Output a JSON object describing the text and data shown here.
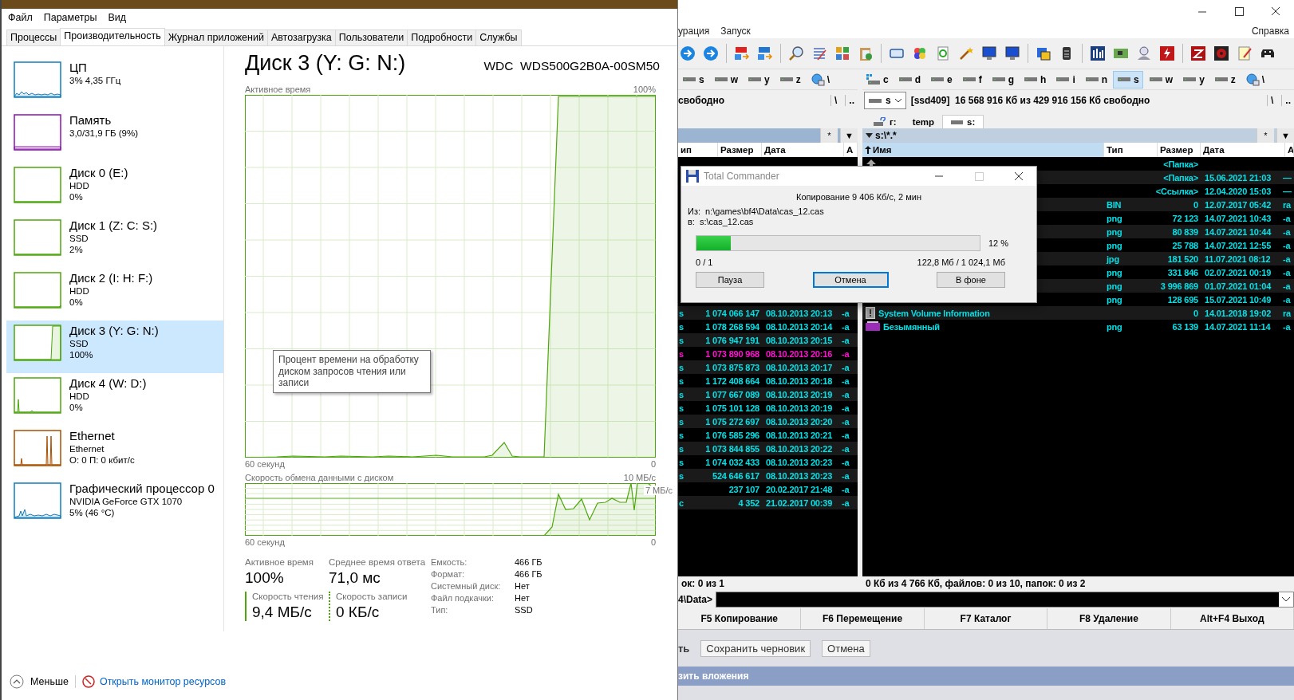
{
  "task_manager": {
    "menu": [
      "Файл",
      "Параметры",
      "Вид"
    ],
    "tabs": [
      {
        "label": "Процессы",
        "selected": false
      },
      {
        "label": "Производительность",
        "selected": true
      },
      {
        "label": "Журнал приложений",
        "selected": false
      },
      {
        "label": "Автозагрузка",
        "selected": false
      },
      {
        "label": "Пользователи",
        "selected": false
      },
      {
        "label": "Подробности",
        "selected": false
      },
      {
        "label": "Службы",
        "selected": false
      }
    ],
    "devices": [
      {
        "name": "ЦП",
        "lines": [
          "3% 4,35 ГГц"
        ],
        "kind": "cpu",
        "selected": false
      },
      {
        "name": "Память",
        "lines": [
          "3,0/31,9 ГБ (9%)"
        ],
        "kind": "memory",
        "selected": false
      },
      {
        "name": "Диск 0 (E:)",
        "lines": [
          "HDD",
          "0%"
        ],
        "kind": "disk",
        "selected": false
      },
      {
        "name": "Диск 1 (Z: C: S:)",
        "lines": [
          "SSD",
          "2%"
        ],
        "kind": "disk",
        "selected": false
      },
      {
        "name": "Диск 2 (I: H: F:)",
        "lines": [
          "HDD",
          "0%"
        ],
        "kind": "disk",
        "selected": false
      },
      {
        "name": "Диск 3 (Y: G: N:)",
        "lines": [
          "SSD",
          "100%"
        ],
        "kind": "disk",
        "selected": true
      },
      {
        "name": "Диск 4 (W: D:)",
        "lines": [
          "HDD",
          "0%"
        ],
        "kind": "disk",
        "selected": false
      },
      {
        "name": "Ethernet",
        "lines": [
          "Ethernet",
          "О: 0 П: 0 кбит/с"
        ],
        "kind": "ethernet",
        "selected": false
      },
      {
        "name": "Графический процессор 0",
        "lines": [
          "NVIDIA GeForce GTX 1070",
          "5%  (46 °C)"
        ],
        "kind": "gpu",
        "selected": false
      }
    ],
    "detail": {
      "title": "Диск 3 (Y: G: N:)",
      "model": "WDC  WDS500G2B0A-00SM50",
      "chart1": {
        "label": "Активное время",
        "max": "100%",
        "xlabel": "60 секунд",
        "min": "0"
      },
      "tooltip": "Процент времени на обработку диском запросов чтения или записи",
      "chart2": {
        "label": "Скорость обмена данными с диском",
        "max": "10 МБ/с",
        "marker": "7 МБ/с",
        "xlabel": "60 секунд",
        "min": "0"
      },
      "stats": [
        {
          "label": "Активное время",
          "value": "100%"
        },
        {
          "label": "Среднее время ответа",
          "value": "71,0 мс"
        }
      ],
      "rates": [
        {
          "label": "Скорость чтения",
          "value": "9,4 МБ/с",
          "kind": "read"
        },
        {
          "label": "Скорость записи",
          "value": "0 КБ/с",
          "kind": "write"
        }
      ],
      "properties": [
        {
          "label": "Емкость:",
          "value": "466 ГБ"
        },
        {
          "label": "Формат:",
          "value": "466 ГБ"
        },
        {
          "label": "Системный диск:",
          "value": "Нет"
        },
        {
          "label": "Файл подкачки:",
          "value": "Нет"
        },
        {
          "label": "Тип:",
          "value": "SSD"
        }
      ]
    },
    "footer": {
      "less": "Меньше",
      "link": "Открыть монитор ресурсов"
    }
  },
  "total_commander": {
    "menu_left": [
      "урация",
      "Запуск"
    ],
    "menu_right": "Справка",
    "left_panel": {
      "drives": [
        {
          "letter": "s",
          "kind": "drive",
          "selected": false
        },
        {
          "letter": "w",
          "kind": "drive",
          "selected": false
        },
        {
          "letter": "y",
          "kind": "drive",
          "selected": false
        },
        {
          "letter": "z",
          "kind": "drive",
          "selected": false
        },
        {
          "letter": "\\",
          "kind": "network",
          "selected": false
        }
      ],
      "free": "свободно",
      "root": "\\",
      "up": "..",
      "header_buttons": [
        "*",
        "▼"
      ],
      "columns": [
        {
          "label": "ип",
          "sorted": false
        },
        {
          "label": "Размер",
          "sorted": false
        },
        {
          "label": "Дата",
          "sorted": false
        },
        {
          "label": "А",
          "sorted": false
        }
      ],
      "rows": [
        {
          "ext": "s",
          "size": "1 074 066 147",
          "date": "08.10.2013 20:13",
          "attr": "-a",
          "color": "#00e1e8"
        },
        {
          "ext": "s",
          "size": "1 078 268 594",
          "date": "08.10.2013 20:14",
          "attr": "-a",
          "color": "#00e1e8"
        },
        {
          "ext": "s",
          "size": "1 076 947 191",
          "date": "08.10.2013 20:15",
          "attr": "-a",
          "color": "#00e1e8"
        },
        {
          "ext": "s",
          "size": "1 073 890 968",
          "date": "08.10.2013 20:16",
          "attr": "-a",
          "color": "#ff10d0"
        },
        {
          "ext": "s",
          "size": "1 073 875 873",
          "date": "08.10.2013 20:17",
          "attr": "-a",
          "color": "#00e1e8"
        },
        {
          "ext": "s",
          "size": "1 172 408 664",
          "date": "08.10.2013 20:18",
          "attr": "-a",
          "color": "#00e1e8"
        },
        {
          "ext": "s",
          "size": "1 077 667 089",
          "date": "08.10.2013 20:19",
          "attr": "-a",
          "color": "#00e1e8"
        },
        {
          "ext": "s",
          "size": "1 075 101 128",
          "date": "08.10.2013 20:19",
          "attr": "-a",
          "color": "#00e1e8"
        },
        {
          "ext": "s",
          "size": "1 075 272 697",
          "date": "08.10.2013 20:20",
          "attr": "-a",
          "color": "#00e1e8"
        },
        {
          "ext": "s",
          "size": "1 076 585 296",
          "date": "08.10.2013 20:21",
          "attr": "-a",
          "color": "#00e1e8"
        },
        {
          "ext": "s",
          "size": "1 073 844 855",
          "date": "08.10.2013 20:22",
          "attr": "-a",
          "color": "#00e1e8"
        },
        {
          "ext": "s",
          "size": "1 074 032 433",
          "date": "08.10.2013 20:23",
          "attr": "-a",
          "color": "#00e1e8"
        },
        {
          "ext": "s",
          "size": "524 646 617",
          "date": "08.10.2013 20:23",
          "attr": "-a",
          "color": "#00e1e8"
        },
        {
          "size": "237 107",
          "date": "20.02.2017 21:48",
          "attr": "-a",
          "color": "#00e1e8"
        },
        {
          "ext": "c",
          "size": "4 352",
          "date": "21.02.2017 00:39",
          "attr": "-a",
          "color": "#00e1e8"
        }
      ],
      "status": "ок: 0 из 1"
    },
    "right_panel": {
      "drives": [
        {
          "letter": "c",
          "kind": "system",
          "selected": false
        },
        {
          "letter": "d",
          "kind": "drive",
          "selected": false
        },
        {
          "letter": "e",
          "kind": "drive",
          "selected": false
        },
        {
          "letter": "f",
          "kind": "drive",
          "selected": false
        },
        {
          "letter": "g",
          "kind": "drive",
          "selected": false
        },
        {
          "letter": "h",
          "kind": "drive",
          "selected": false
        },
        {
          "letter": "i",
          "kind": "drive",
          "selected": false
        },
        {
          "letter": "n",
          "kind": "drive",
          "selected": false
        },
        {
          "letter": "s",
          "kind": "drive",
          "selected": true
        },
        {
          "letter": "w",
          "kind": "drive",
          "selected": false
        },
        {
          "letter": "y",
          "kind": "drive",
          "selected": false
        },
        {
          "letter": "z",
          "kind": "drive",
          "selected": false
        },
        {
          "letter": "\\",
          "kind": "network",
          "selected": false
        }
      ],
      "drive_select": "s",
      "info": "[ssd409]  16 568 916 Кб из 429 916 156 Кб свободно",
      "root": "\\",
      "up": "..",
      "tabs": [
        {
          "label": "г:",
          "kind": "unknown",
          "selected": false
        },
        {
          "label": "temp",
          "kind": "folder",
          "selected": false
        },
        {
          "label": "s:",
          "kind": "drive",
          "selected": true
        }
      ],
      "filter": "s:\\*.*",
      "header_buttons": [
        "*",
        "▼"
      ],
      "columns": [
        {
          "label": "Имя",
          "sorted": true
        },
        {
          "label": "Тип",
          "sorted": false
        },
        {
          "label": "Размер",
          "sorted": false
        },
        {
          "label": "Дата",
          "sorted": false
        },
        {
          "label": "А",
          "sorted": false
        }
      ],
      "rows": [
        {
          "kind": "parent",
          "size": "<Папка>"
        },
        {
          "size": "<Папка>",
          "date": "15.06.2021 21:03",
          "attr": "—"
        },
        {
          "size": "<Ссылка>",
          "date": "12.04.2020 15:03",
          "attr": "—"
        },
        {
          "type": "BIN",
          "size": "0",
          "date": "12.07.2017 05:42",
          "attr": "ra"
        },
        {
          "type": "png",
          "size": "72 123",
          "date": "14.07.2021 10:43",
          "attr": "-a"
        },
        {
          "type": "png",
          "size": "80 839",
          "date": "14.07.2021 10:44",
          "attr": "-a"
        },
        {
          "type": "png",
          "size": "25 788",
          "date": "14.07.2021 12:55",
          "attr": "-a"
        },
        {
          "type": "jpg",
          "size": "181 520",
          "date": "11.07.2021 08:12",
          "attr": "-a"
        },
        {
          "type": "png",
          "size": "331 846",
          "date": "02.07.2021 00:19",
          "attr": "-a"
        },
        {
          "type": "png",
          "size": "3 996 869",
          "date": "01.07.2021 01:04",
          "attr": "-a"
        },
        {
          "type": "png",
          "size": "128 695",
          "date": "15.07.2021 10:49",
          "attr": "-a"
        },
        {
          "kind": "system",
          "name": "System Volume Information",
          "size": "0",
          "date": "14.01.2018 19:02",
          "attr": "ra"
        },
        {
          "kind": "image",
          "name": "Безымянный",
          "type": "png",
          "size": "63 139",
          "date": "14.07.2021 11:14",
          "attr": "-a"
        }
      ],
      "status": "0 Кб из 4 766 Кб, файлов: 0 из 10, папок: 0 из 2"
    },
    "command_prompt": "4\\Data>",
    "fkeys": [
      "F5 Копирование",
      "F6 Перемещение",
      "F7 Каталог",
      "F8 Удаление",
      "Alt+F4 Выход"
    ],
    "dialog": {
      "title": "Total Commander",
      "maximize_disabled": true,
      "status": "Копирование 9 406 Кб/с, 2 мин",
      "from": "Из:  n:\\games\\bf4\\Data\\cas_12.cas",
      "to": "в:  s:\\cas_12.cas",
      "progress": {
        "level": 0.12,
        "percent": "12 %"
      },
      "count": "0 / 1",
      "amount": "122,8 Мб / 1 024,1 Мб",
      "buttons": [
        {
          "label": "Пауза",
          "focused": false
        },
        {
          "label": "Отмена",
          "focused": true
        },
        {
          "label": "В фоне",
          "focused": false
        }
      ]
    }
  },
  "background_app": {
    "buttons": [
      "ть",
      "Сохранить черновик",
      "Отмена"
    ],
    "bar": "зить вложения"
  }
}
